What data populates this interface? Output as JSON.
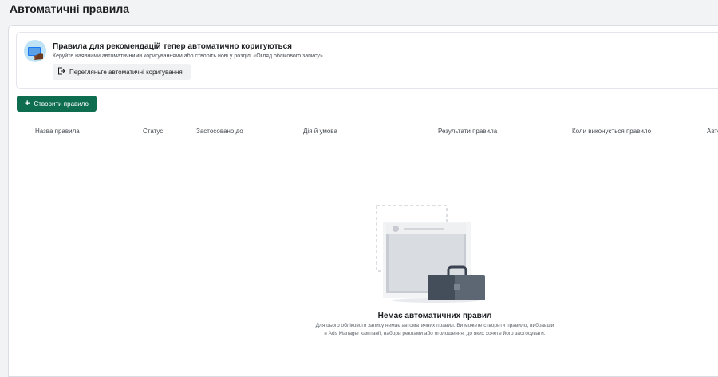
{
  "page": {
    "title": "Автоматичні правила"
  },
  "notice": {
    "title": "Правила для рекомендацій тепер автоматично коригуються",
    "text": "Керуйте наявними автоматичними коригуваннями або створіть нові у розділі «Огляд облікового запису».",
    "button_label": "Перегляньте автоматичні коригування",
    "illustration_icon": "monitor-hand-icon"
  },
  "toolbar": {
    "create_label": "Створити правило",
    "accent": "#0e6d4f"
  },
  "table": {
    "columns": [
      "Назва правила",
      "Статус",
      "Застосовано до",
      "Дія й умова",
      "Результати правила",
      "Коли виконується правило",
      "Авто"
    ]
  },
  "empty_state": {
    "title": "Немає автоматичних правил",
    "description": "Для цього облікового запису немає автоматичних правил. Ви можете створити правило, вибравши в Ads Manager кампанії, набори реклами або оголошення, до яких хочете його застосувати."
  }
}
